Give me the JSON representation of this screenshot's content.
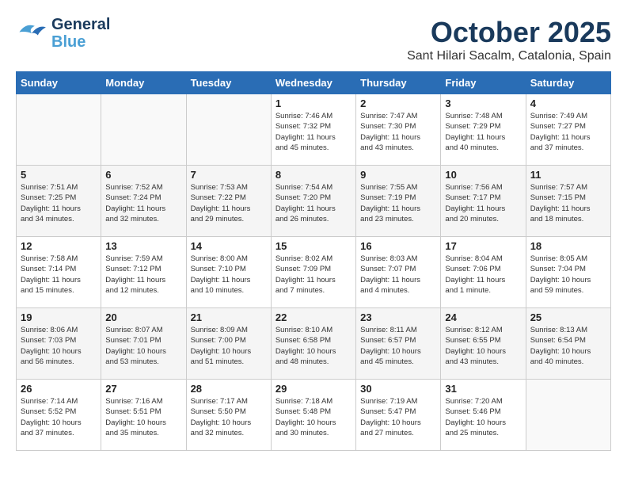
{
  "header": {
    "logo_general": "General",
    "logo_blue": "Blue",
    "month": "October 2025",
    "location": "Sant Hilari Sacalm, Catalonia, Spain"
  },
  "days_of_week": [
    "Sunday",
    "Monday",
    "Tuesday",
    "Wednesday",
    "Thursday",
    "Friday",
    "Saturday"
  ],
  "weeks": [
    [
      {
        "day": "",
        "info": ""
      },
      {
        "day": "",
        "info": ""
      },
      {
        "day": "",
        "info": ""
      },
      {
        "day": "1",
        "info": "Sunrise: 7:46 AM\nSunset: 7:32 PM\nDaylight: 11 hours\nand 45 minutes."
      },
      {
        "day": "2",
        "info": "Sunrise: 7:47 AM\nSunset: 7:30 PM\nDaylight: 11 hours\nand 43 minutes."
      },
      {
        "day": "3",
        "info": "Sunrise: 7:48 AM\nSunset: 7:29 PM\nDaylight: 11 hours\nand 40 minutes."
      },
      {
        "day": "4",
        "info": "Sunrise: 7:49 AM\nSunset: 7:27 PM\nDaylight: 11 hours\nand 37 minutes."
      }
    ],
    [
      {
        "day": "5",
        "info": "Sunrise: 7:51 AM\nSunset: 7:25 PM\nDaylight: 11 hours\nand 34 minutes."
      },
      {
        "day": "6",
        "info": "Sunrise: 7:52 AM\nSunset: 7:24 PM\nDaylight: 11 hours\nand 32 minutes."
      },
      {
        "day": "7",
        "info": "Sunrise: 7:53 AM\nSunset: 7:22 PM\nDaylight: 11 hours\nand 29 minutes."
      },
      {
        "day": "8",
        "info": "Sunrise: 7:54 AM\nSunset: 7:20 PM\nDaylight: 11 hours\nand 26 minutes."
      },
      {
        "day": "9",
        "info": "Sunrise: 7:55 AM\nSunset: 7:19 PM\nDaylight: 11 hours\nand 23 minutes."
      },
      {
        "day": "10",
        "info": "Sunrise: 7:56 AM\nSunset: 7:17 PM\nDaylight: 11 hours\nand 20 minutes."
      },
      {
        "day": "11",
        "info": "Sunrise: 7:57 AM\nSunset: 7:15 PM\nDaylight: 11 hours\nand 18 minutes."
      }
    ],
    [
      {
        "day": "12",
        "info": "Sunrise: 7:58 AM\nSunset: 7:14 PM\nDaylight: 11 hours\nand 15 minutes."
      },
      {
        "day": "13",
        "info": "Sunrise: 7:59 AM\nSunset: 7:12 PM\nDaylight: 11 hours\nand 12 minutes."
      },
      {
        "day": "14",
        "info": "Sunrise: 8:00 AM\nSunset: 7:10 PM\nDaylight: 11 hours\nand 10 minutes."
      },
      {
        "day": "15",
        "info": "Sunrise: 8:02 AM\nSunset: 7:09 PM\nDaylight: 11 hours\nand 7 minutes."
      },
      {
        "day": "16",
        "info": "Sunrise: 8:03 AM\nSunset: 7:07 PM\nDaylight: 11 hours\nand 4 minutes."
      },
      {
        "day": "17",
        "info": "Sunrise: 8:04 AM\nSunset: 7:06 PM\nDaylight: 11 hours\nand 1 minute."
      },
      {
        "day": "18",
        "info": "Sunrise: 8:05 AM\nSunset: 7:04 PM\nDaylight: 10 hours\nand 59 minutes."
      }
    ],
    [
      {
        "day": "19",
        "info": "Sunrise: 8:06 AM\nSunset: 7:03 PM\nDaylight: 10 hours\nand 56 minutes."
      },
      {
        "day": "20",
        "info": "Sunrise: 8:07 AM\nSunset: 7:01 PM\nDaylight: 10 hours\nand 53 minutes."
      },
      {
        "day": "21",
        "info": "Sunrise: 8:09 AM\nSunset: 7:00 PM\nDaylight: 10 hours\nand 51 minutes."
      },
      {
        "day": "22",
        "info": "Sunrise: 8:10 AM\nSunset: 6:58 PM\nDaylight: 10 hours\nand 48 minutes."
      },
      {
        "day": "23",
        "info": "Sunrise: 8:11 AM\nSunset: 6:57 PM\nDaylight: 10 hours\nand 45 minutes."
      },
      {
        "day": "24",
        "info": "Sunrise: 8:12 AM\nSunset: 6:55 PM\nDaylight: 10 hours\nand 43 minutes."
      },
      {
        "day": "25",
        "info": "Sunrise: 8:13 AM\nSunset: 6:54 PM\nDaylight: 10 hours\nand 40 minutes."
      }
    ],
    [
      {
        "day": "26",
        "info": "Sunrise: 7:14 AM\nSunset: 5:52 PM\nDaylight: 10 hours\nand 37 minutes."
      },
      {
        "day": "27",
        "info": "Sunrise: 7:16 AM\nSunset: 5:51 PM\nDaylight: 10 hours\nand 35 minutes."
      },
      {
        "day": "28",
        "info": "Sunrise: 7:17 AM\nSunset: 5:50 PM\nDaylight: 10 hours\nand 32 minutes."
      },
      {
        "day": "29",
        "info": "Sunrise: 7:18 AM\nSunset: 5:48 PM\nDaylight: 10 hours\nand 30 minutes."
      },
      {
        "day": "30",
        "info": "Sunrise: 7:19 AM\nSunset: 5:47 PM\nDaylight: 10 hours\nand 27 minutes."
      },
      {
        "day": "31",
        "info": "Sunrise: 7:20 AM\nSunset: 5:46 PM\nDaylight: 10 hours\nand 25 minutes."
      },
      {
        "day": "",
        "info": ""
      }
    ]
  ]
}
